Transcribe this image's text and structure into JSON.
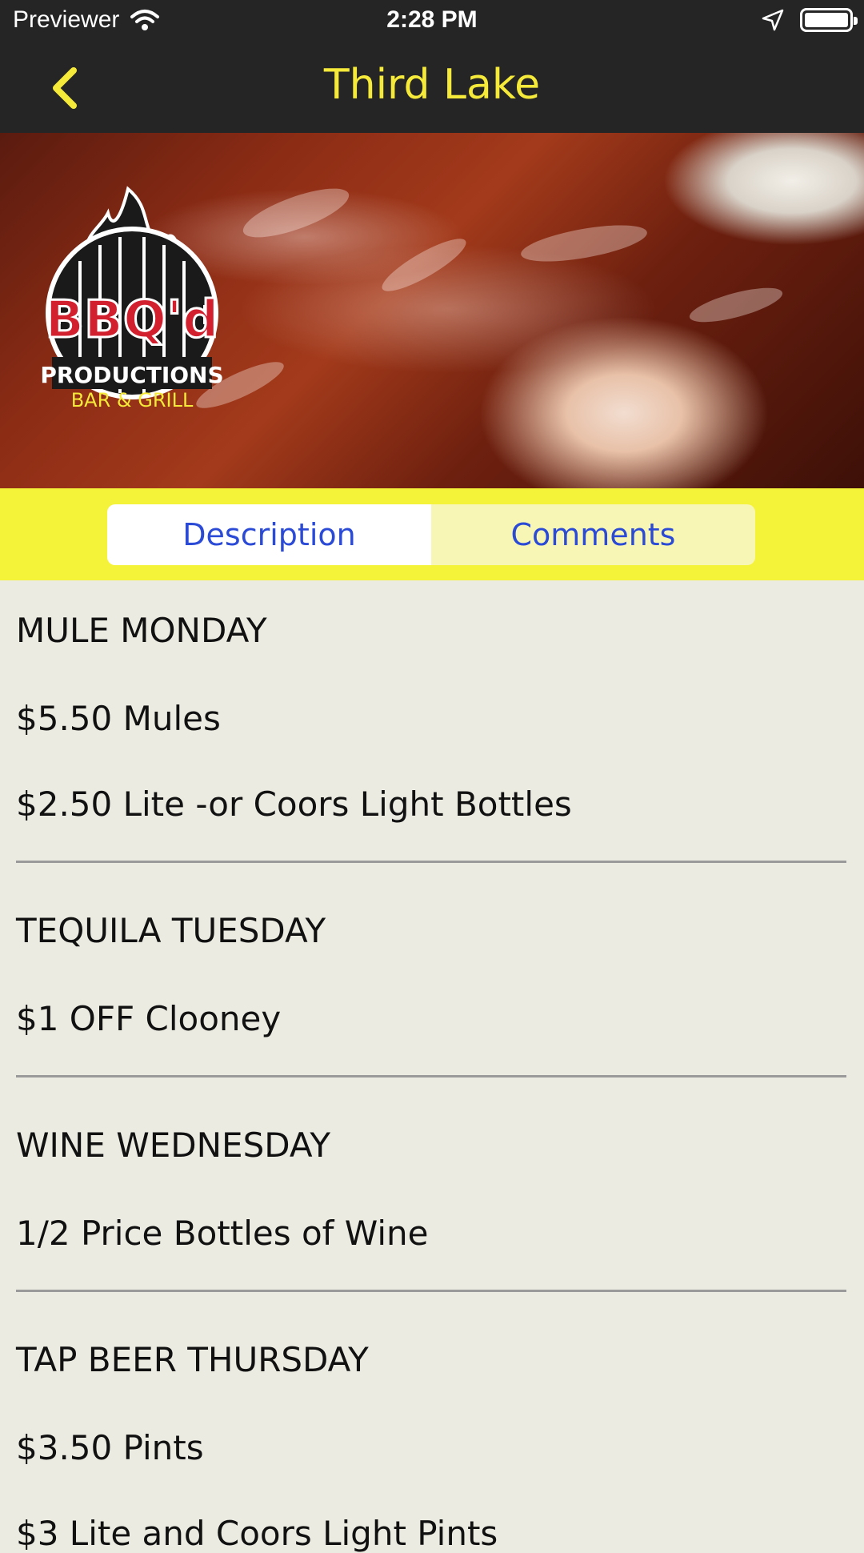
{
  "status_bar": {
    "carrier": "Previewer",
    "time": "2:28 PM"
  },
  "nav": {
    "title": "Third Lake"
  },
  "hero": {
    "logo_text": "BBQ'd",
    "logo_sub1": "PRODUCTIONS",
    "logo_sub2": "BAR & GRILL"
  },
  "tabs": [
    {
      "label": "Description",
      "selected": true
    },
    {
      "label": "Comments",
      "selected": false
    }
  ],
  "specials": [
    {
      "heading": "MULE MONDAY",
      "lines": [
        "$5.50 Mules",
        "$2.50 Lite -or Coors Light Bottles"
      ]
    },
    {
      "heading": "TEQUILA TUESDAY",
      "lines": [
        "$1 OFF Clooney"
      ]
    },
    {
      "heading": "WINE WEDNESDAY",
      "lines": [
        "1/2 Price Bottles of Wine"
      ]
    },
    {
      "heading": "TAP BEER THURSDAY",
      "lines": [
        "$3.50 Pints",
        "$3 Lite and Coors Light Pints"
      ]
    }
  ],
  "colors": {
    "accent_yellow": "#f5ea3a",
    "tab_text": "#2b4bd6",
    "bar_dark": "#252525",
    "content_bg": "#ecebe2"
  }
}
